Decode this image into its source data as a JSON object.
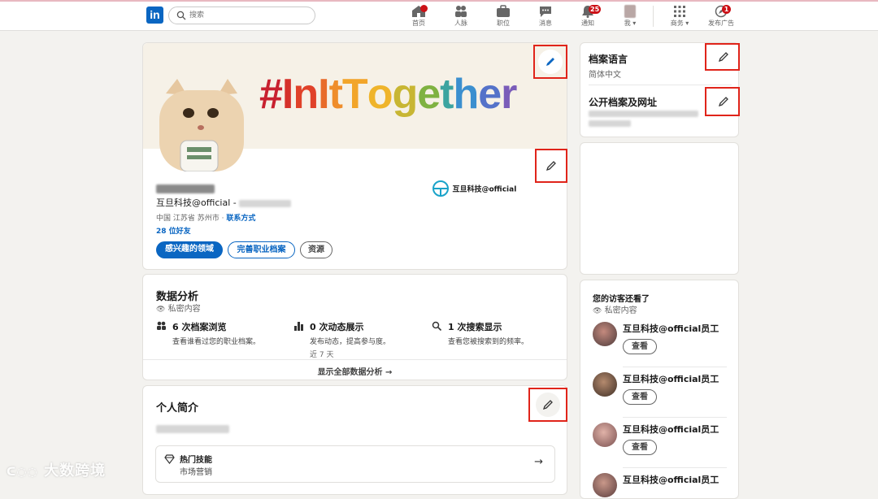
{
  "nav": {
    "search_placeholder": "搜索",
    "items": [
      {
        "label": "首页",
        "badge": ""
      },
      {
        "label": "人脉",
        "badge": ""
      },
      {
        "label": "职位",
        "badge": ""
      },
      {
        "label": "消息",
        "badge": ""
      },
      {
        "label": "通知",
        "badge": "25"
      },
      {
        "label": "我",
        "badge": ""
      },
      {
        "label": "商务",
        "badge": ""
      },
      {
        "label": "发布广告",
        "badge": "1"
      }
    ]
  },
  "profile": {
    "banner_text": "#InItTogether",
    "headline": "互旦科技@official - ",
    "location": "中国 江苏省 苏州市 · ",
    "contact_link": "联系方式",
    "connections": "28 位好友",
    "company_name": "互旦科技@official",
    "buttons": {
      "open_to": "感兴趣的领域",
      "add_section": "完善职业档案",
      "more": "资源"
    }
  },
  "analytics": {
    "title": "数据分析",
    "privacy": "私密内容",
    "stats": [
      {
        "title": "6 次档案浏览",
        "desc": "查看谁看过您的职业档案。",
        "extra": ""
      },
      {
        "title": "0 次动态展示",
        "desc": "发布动态，提高参与度。",
        "extra": "近 7 天"
      },
      {
        "title": "1 次搜索显示",
        "desc": "查看您被搜索到的频率。",
        "extra": ""
      }
    ],
    "show_all": "显示全部数据分析 →"
  },
  "about": {
    "title": "个人简介",
    "skills_title": "热门技能",
    "skills_value": "市场营销"
  },
  "sidebar": {
    "profile_language_title": "档案语言",
    "profile_language_value": "简体中文",
    "public_profile_title": "公开档案及网址"
  },
  "visitors": {
    "title": "您的访客还看了",
    "privacy": "私密内容",
    "view_label": "查看",
    "people": [
      {
        "name": "互旦科技@official员工"
      },
      {
        "name": "互旦科技@official员工"
      },
      {
        "name": "互旦科技@official员工"
      },
      {
        "name": "互旦科技@official员工"
      }
    ]
  },
  "watermark": "大数跨境",
  "colors": {
    "accent": "#0a66c2",
    "highlight": "#e0241a",
    "badge": "#cc1016"
  }
}
